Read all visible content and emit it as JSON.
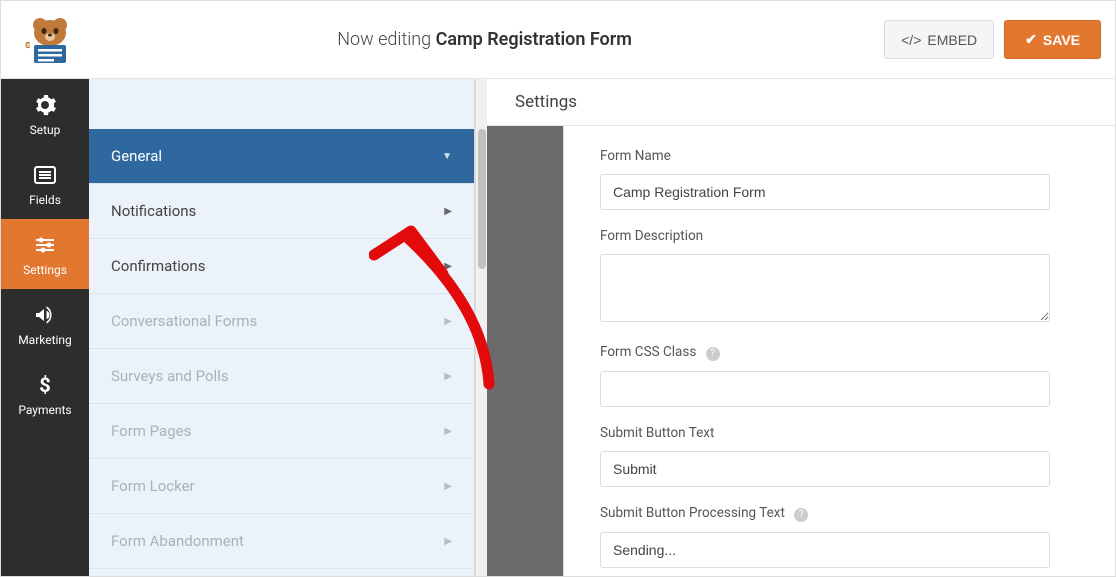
{
  "header": {
    "editing_prefix": "Now editing ",
    "form_title": "Camp Registration Form",
    "embed_label": "EMBED",
    "save_label": "SAVE"
  },
  "nav": {
    "setup": "Setup",
    "fields": "Fields",
    "settings": "Settings",
    "marketing": "Marketing",
    "payments": "Payments"
  },
  "settings_sidebar": {
    "items": [
      {
        "label": "General",
        "active": true
      },
      {
        "label": "Notifications"
      },
      {
        "label": "Confirmations"
      },
      {
        "label": "Conversational Forms",
        "disabled": true
      },
      {
        "label": "Surveys and Polls",
        "disabled": true
      },
      {
        "label": "Form Pages",
        "disabled": true
      },
      {
        "label": "Form Locker",
        "disabled": true
      },
      {
        "label": "Form Abandonment",
        "disabled": true
      }
    ]
  },
  "content": {
    "title": "Settings",
    "form_name_label": "Form Name",
    "form_name_value": "Camp Registration Form",
    "form_description_label": "Form Description",
    "form_description_value": "",
    "form_css_label": "Form CSS Class",
    "form_css_value": "",
    "submit_text_label": "Submit Button Text",
    "submit_text_value": "Submit",
    "submit_processing_label": "Submit Button Processing Text",
    "submit_processing_value": "Sending..."
  }
}
